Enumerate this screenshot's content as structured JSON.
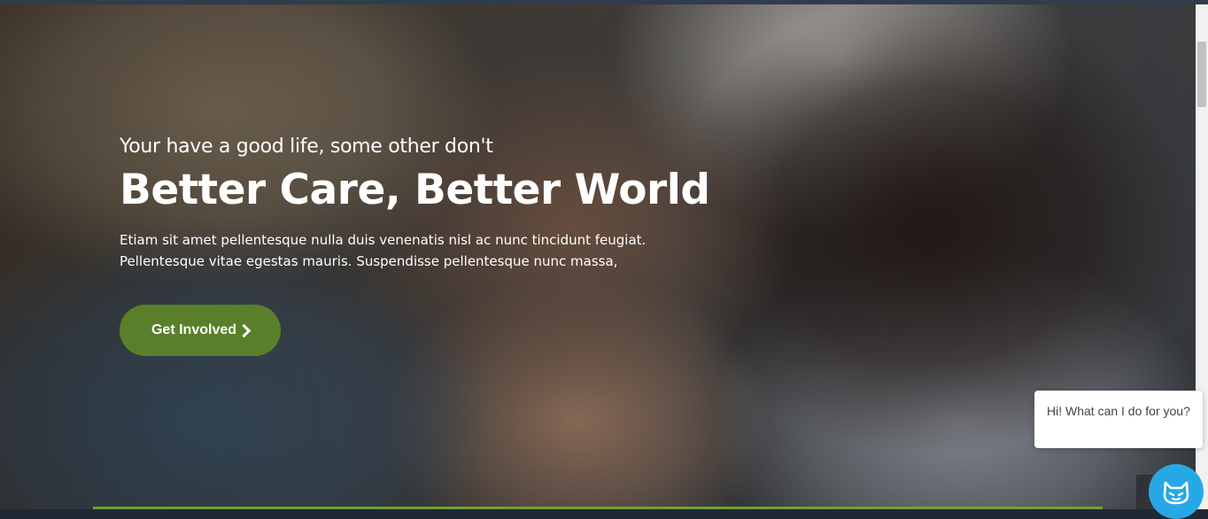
{
  "hero": {
    "tagline": "Your have a good life, some other don't",
    "headline": "Better Care, Better World",
    "body_line1": "Etiam sit amet pellentesque nulla duis venenatis nisl ac nunc tincidunt feugiat.",
    "body_line2": "Pellentesque vitae egestas mauris. Suspendisse pellentesque nunc massa,",
    "cta_label": "Get Involved",
    "cta_icon": "chevron-right-icon"
  },
  "chat": {
    "message": "Hi! What can I do for you?",
    "button_icon": "cat-face-icon"
  },
  "colors": {
    "cta_green": "#5a7f2a",
    "chat_blue": "#27a8e6",
    "accent_line": "#6fa138"
  }
}
